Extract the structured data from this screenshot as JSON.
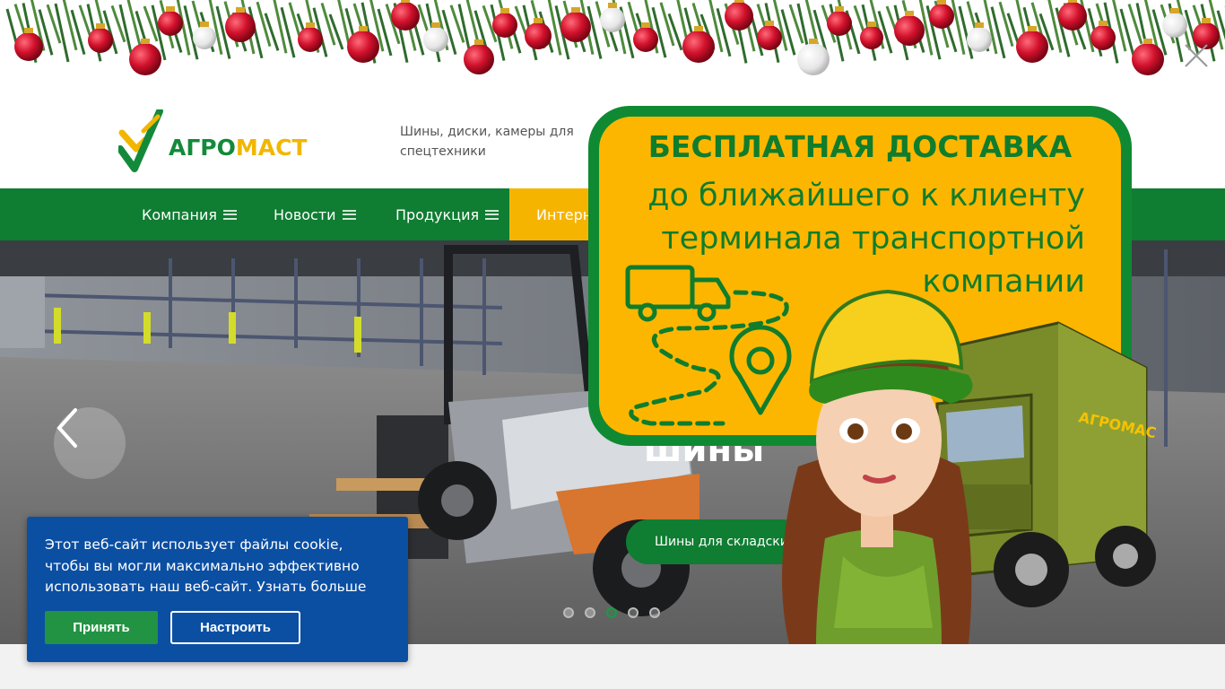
{
  "brand": {
    "logo_part1": "АГРО",
    "logo_part2": "МАСТ",
    "tagline": "Шины, диски, камеры для спецтехники"
  },
  "nav": {
    "items": [
      {
        "label": "Компания"
      },
      {
        "label": "Новости"
      },
      {
        "label": "Продукция"
      }
    ],
    "shop_label": "Интерн"
  },
  "hero": {
    "title": "шины",
    "button_label": "Шины для складских",
    "prev_icon": "chevron-left-icon",
    "slides_count": 5,
    "active_slide": 3
  },
  "promo": {
    "headline": "БЕСПЛАТНАЯ ДОСТАВКА",
    "lines": [
      "до ближайшего к клиенту",
      "терминала транспортной",
      "компании"
    ],
    "truck_brand": "АГРОМАСТ",
    "close_icon": "close-icon"
  },
  "cookie": {
    "text": "Этот веб-сайт использует файлы cookie, чтобы вы могли максимально эффективно использовать наш веб-сайт. Узнать больше",
    "accept_label": "Принять",
    "settings_label": "Настроить"
  },
  "colors": {
    "brand_green": "#0f7d32",
    "brand_yellow": "#f5b400",
    "cookie_blue": "#0b4fa3",
    "accept_green": "#229343"
  }
}
